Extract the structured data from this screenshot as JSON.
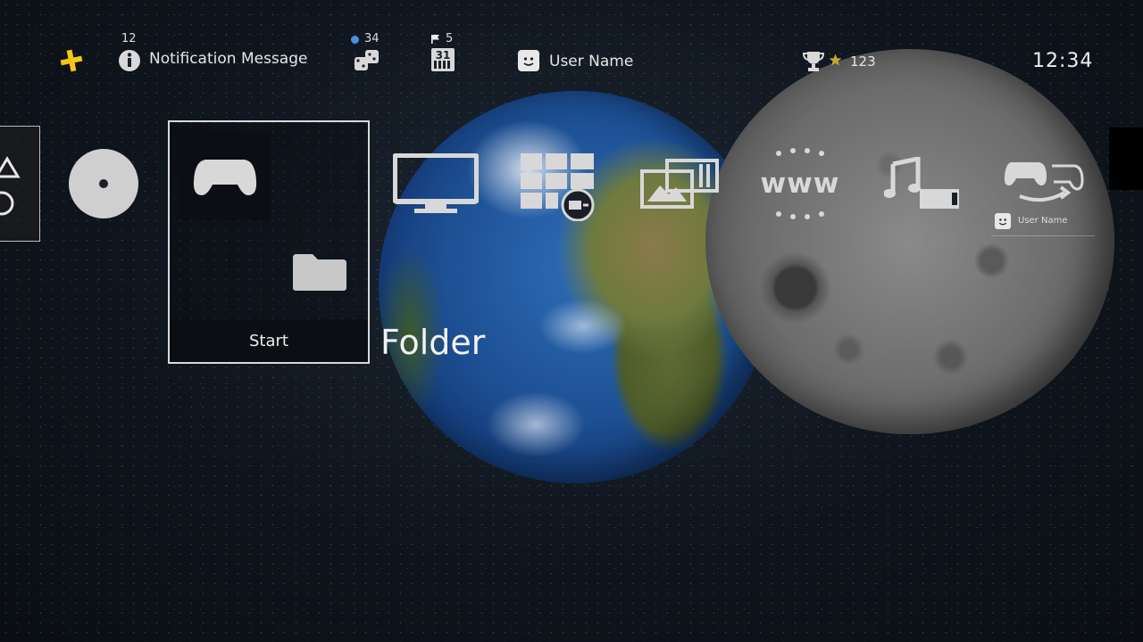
{
  "topbar": {
    "notification_count": "12",
    "notification_text": "Notification Message",
    "friends_count": "34",
    "events_count": "5",
    "calendar_day": "31",
    "user_name": "User Name",
    "trophy_count": "123",
    "clock": "12:34"
  },
  "tiles": {
    "start_label": "Start",
    "folder_label": "Folder",
    "www_label": "www",
    "mini_user_name": "User Name"
  },
  "icons": [
    "ps-plus-icon",
    "info-icon",
    "friends-icon",
    "calendar-icon",
    "user-avatar-icon",
    "trophy-icon",
    "ps-logo-icon",
    "disc-icon",
    "controller-icon",
    "folder-icon",
    "tv-icon",
    "apps-icon",
    "capture-gallery-icon",
    "web-browser-icon",
    "music-icon",
    "share-play-icon"
  ],
  "colors": {
    "plus_yellow": "#f5c518",
    "online_blue": "#4a8fe0",
    "tile_border": "#d9d9d9"
  }
}
